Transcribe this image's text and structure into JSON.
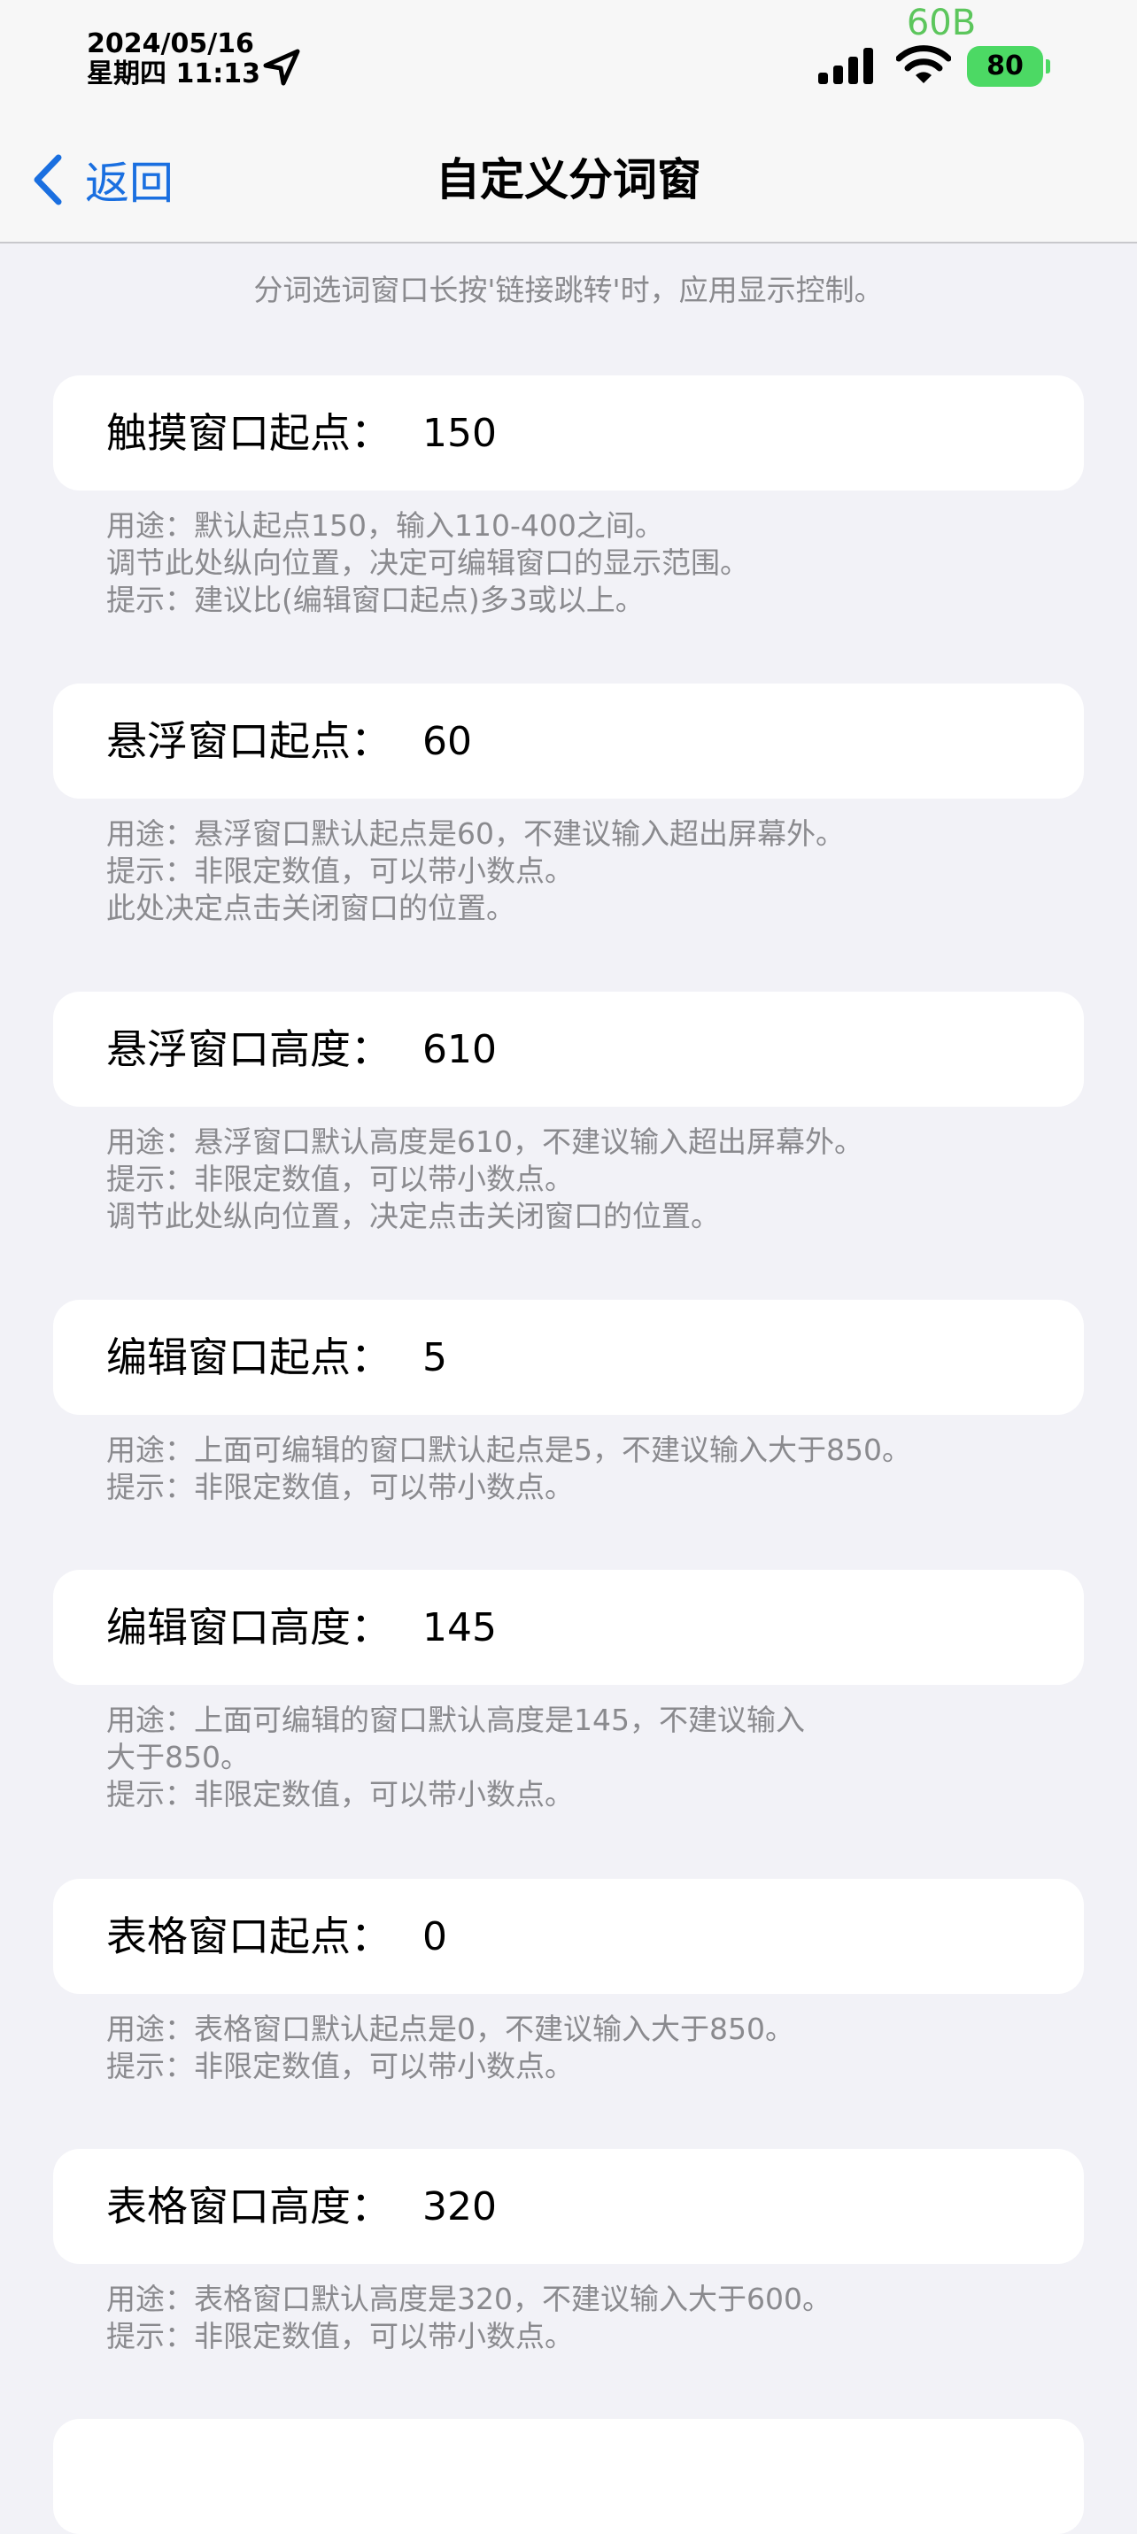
{
  "status_bar": {
    "date": "2024/05/16",
    "time": "星期四 11:13",
    "network_speed": "60B",
    "battery_level": "80",
    "battery_color": "#4cd964",
    "speed_color": "#5cc65c"
  },
  "nav": {
    "back_label": "返回",
    "title": "自定义分词窗",
    "accent_color": "#1a6fe0"
  },
  "intro": "分词选词窗口长按'链接跳转'时，应用显示控制。",
  "fields": [
    {
      "label": "触摸窗口起点：",
      "value": "150",
      "hint": [
        "用途：默认起点150，输入110-400之间。",
        "调节此处纵向位置，决定可编辑窗口的显示范围。",
        "提示：建议比(编辑窗口起点)多3或以上。"
      ]
    },
    {
      "label": "悬浮窗口起点：",
      "value": "60",
      "hint": [
        "用途：悬浮窗口默认起点是60，不建议输入超出屏幕外。",
        "提示：非限定数值，可以带小数点。",
        "此处决定点击关闭窗口的位置。"
      ]
    },
    {
      "label": "悬浮窗口高度：",
      "value": "610",
      "hint": [
        "用途：悬浮窗口默认高度是610，不建议输入超出屏幕外。",
        "提示：非限定数值，可以带小数点。",
        "调节此处纵向位置，决定点击关闭窗口的位置。"
      ]
    },
    {
      "label": "编辑窗口起点：",
      "value": "5",
      "hint": [
        "用途：上面可编辑的窗口默认起点是5，不建议输入大于850。",
        "提示：非限定数值，可以带小数点。"
      ]
    },
    {
      "label": "编辑窗口高度：",
      "value": "145",
      "hint": [
        "用途：上面可编辑的窗口默认高度是145，不建议输入",
        "大于850。",
        "提示：非限定数值，可以带小数点。"
      ]
    },
    {
      "label": "表格窗口起点：",
      "value": "0",
      "hint": [
        "用途：表格窗口默认起点是0，不建议输入大于850。",
        "提示：非限定数值，可以带小数点。"
      ]
    },
    {
      "label": "表格窗口高度：",
      "value": "320",
      "hint": [
        "用途：表格窗口默认高度是320，不建议输入大于600。",
        "提示：非限定数值，可以带小数点。"
      ]
    }
  ]
}
